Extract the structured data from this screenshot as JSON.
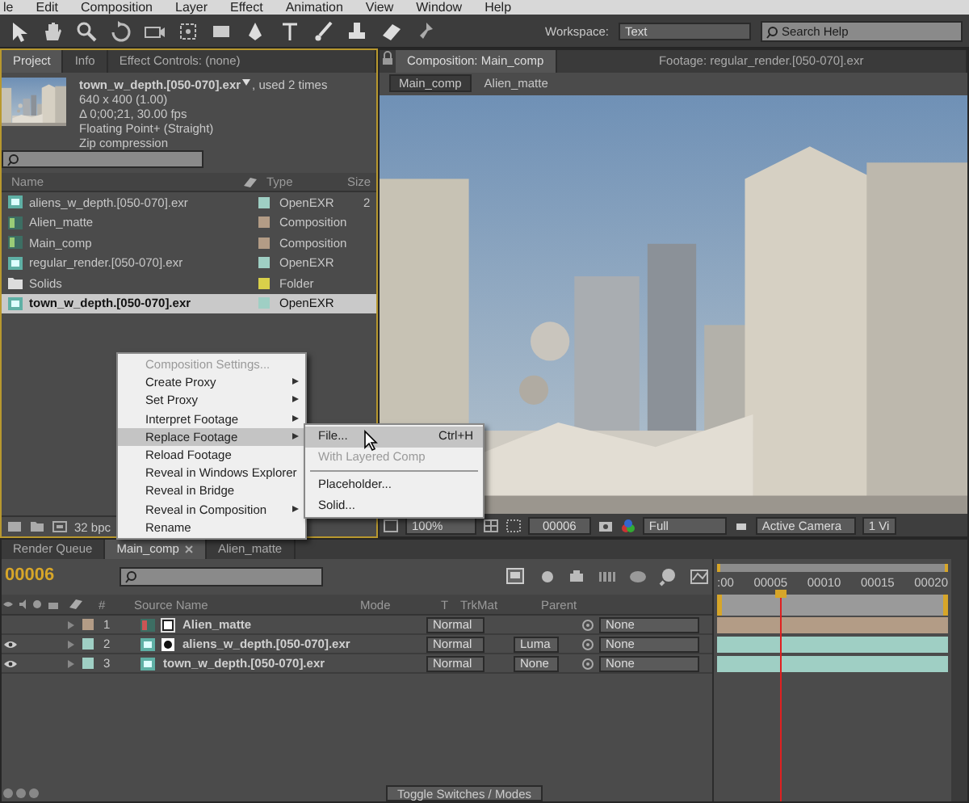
{
  "menu_bar": [
    "le",
    "Edit",
    "Composition",
    "Layer",
    "Effect",
    "Animation",
    "View",
    "Window",
    "Help"
  ],
  "toolbar": {
    "workspace_label": "Workspace:",
    "workspace": "Text",
    "search": {
      "placeholder": "Search Help"
    }
  },
  "project_panel": {
    "tabs": [
      {
        "label": "Project",
        "selected": true
      },
      {
        "label": "Info",
        "selected": false
      },
      {
        "label": "Effect Controls: (none)",
        "selected": false
      }
    ],
    "info": {
      "name": "town_w_depth.[050-070].exr",
      "usage": ", used 2 times",
      "lines": [
        "640 x 400 (1.00)",
        "Δ 0;00;21, 30.00 fps",
        "Floating Point+ (Straight)",
        "Zip compression"
      ]
    },
    "columns": [
      "Name",
      "Type",
      "Size"
    ],
    "items": [
      {
        "name": "aliens_w_depth.[050-070].exr",
        "type": "OpenEXR",
        "size": "2",
        "kind": "footage",
        "color": "#9fcfc4",
        "selected": false
      },
      {
        "name": "Alien_matte",
        "type": "Composition",
        "kind": "comp",
        "color": "#b39c86",
        "selected": false
      },
      {
        "name": "Main_comp",
        "type": "Composition",
        "kind": "comp",
        "color": "#b39c86",
        "selected": false
      },
      {
        "name": "regular_render.[050-070].exr",
        "type": "OpenEXR",
        "kind": "footage",
        "color": "#9fcfc4",
        "selected": false
      },
      {
        "name": "Solids",
        "type": "Folder",
        "kind": "folder",
        "color": "#d9d04a",
        "selected": false
      },
      {
        "name": "town_w_depth.[050-070].exr",
        "type": "OpenEXR",
        "kind": "footage",
        "color": "#9fcfc4",
        "selected": true
      }
    ],
    "footer": "32 bpc"
  },
  "context_menu": {
    "items": [
      {
        "label": "Composition Settings...",
        "disabled": true,
        "submenu": false,
        "highlighted": false
      },
      {
        "label": "Create Proxy",
        "disabled": false,
        "submenu": true,
        "highlighted": false
      },
      {
        "label": "Set Proxy",
        "disabled": false,
        "submenu": true,
        "highlighted": false
      },
      {
        "label": "Interpret Footage",
        "disabled": false,
        "submenu": true,
        "highlighted": false
      },
      {
        "label": "Replace Footage",
        "disabled": false,
        "submenu": true,
        "highlighted": true
      },
      {
        "label": "Reload Footage",
        "disabled": false,
        "submenu": false,
        "highlighted": false
      },
      {
        "label": "Reveal in Windows Explorer",
        "disabled": false,
        "submenu": false,
        "highlighted": false
      },
      {
        "label": "Reveal in Bridge",
        "disabled": false,
        "submenu": false,
        "highlighted": false
      },
      {
        "label": "Reveal in Composition",
        "disabled": false,
        "submenu": true,
        "highlighted": false
      },
      {
        "label": "Rename",
        "disabled": false,
        "submenu": false,
        "highlighted": false
      }
    ]
  },
  "submenu": {
    "items": [
      {
        "kind": "item",
        "label": "File...",
        "shortcut": "Ctrl+H",
        "disabled": false,
        "highlighted": true
      },
      {
        "kind": "item",
        "label": "With Layered Comp",
        "disabled": true,
        "highlighted": false
      },
      {
        "kind": "separator"
      },
      {
        "kind": "item",
        "label": "Placeholder...",
        "disabled": false,
        "highlighted": false
      },
      {
        "kind": "item",
        "label": "Solid...",
        "disabled": false,
        "highlighted": false
      }
    ]
  },
  "composition_panel": {
    "tabs": [
      {
        "label": "Composition: Main_comp",
        "selected": true
      },
      {
        "label": "Footage: regular_render.[050-070].exr",
        "selected": false
      }
    ],
    "breadcrumbs": [
      {
        "label": "Main_comp",
        "selected": true
      },
      {
        "label": "Alien_matte",
        "selected": false
      }
    ],
    "controls": {
      "zoom": "100%",
      "timecode": "00006",
      "resolution": "Full",
      "camera": "Active Camera",
      "views": "1 Vi"
    }
  },
  "timeline": {
    "tabs": [
      {
        "label": "Render Queue",
        "selected": false
      },
      {
        "label": "Main_comp",
        "selected": true
      },
      {
        "label": "Alien_matte",
        "selected": false
      }
    ],
    "timecode": "00006",
    "columns": [
      "#",
      "Source Name",
      "Mode",
      "T",
      "TrkMat",
      "Parent"
    ],
    "layers": [
      {
        "number": "1",
        "name": "Alien_matte",
        "kind": "comp",
        "is_matte": true,
        "has_matte": false,
        "visible": false,
        "color": "#b39c86",
        "mode": "Normal",
        "parent": "None"
      },
      {
        "number": "2",
        "name": "aliens_w_depth.[050-070].exr",
        "kind": "footage",
        "is_matte": false,
        "has_matte": true,
        "visible": true,
        "color": "#9fcfc4",
        "mode": "Normal",
        "trkmat": "Luma",
        "parent": "None"
      },
      {
        "number": "3",
        "name": "town_w_depth.[050-070].exr",
        "kind": "footage",
        "is_matte": false,
        "has_matte": false,
        "visible": true,
        "color": "#9fcfc4",
        "mode": "Normal",
        "trkmat": "None",
        "parent": "None"
      }
    ],
    "ruler": [
      ":00",
      "00005",
      "00010",
      "00015",
      "00020"
    ],
    "playhead": {
      "level": 0.28
    },
    "toggle_button": "Toggle Switches / Modes"
  }
}
